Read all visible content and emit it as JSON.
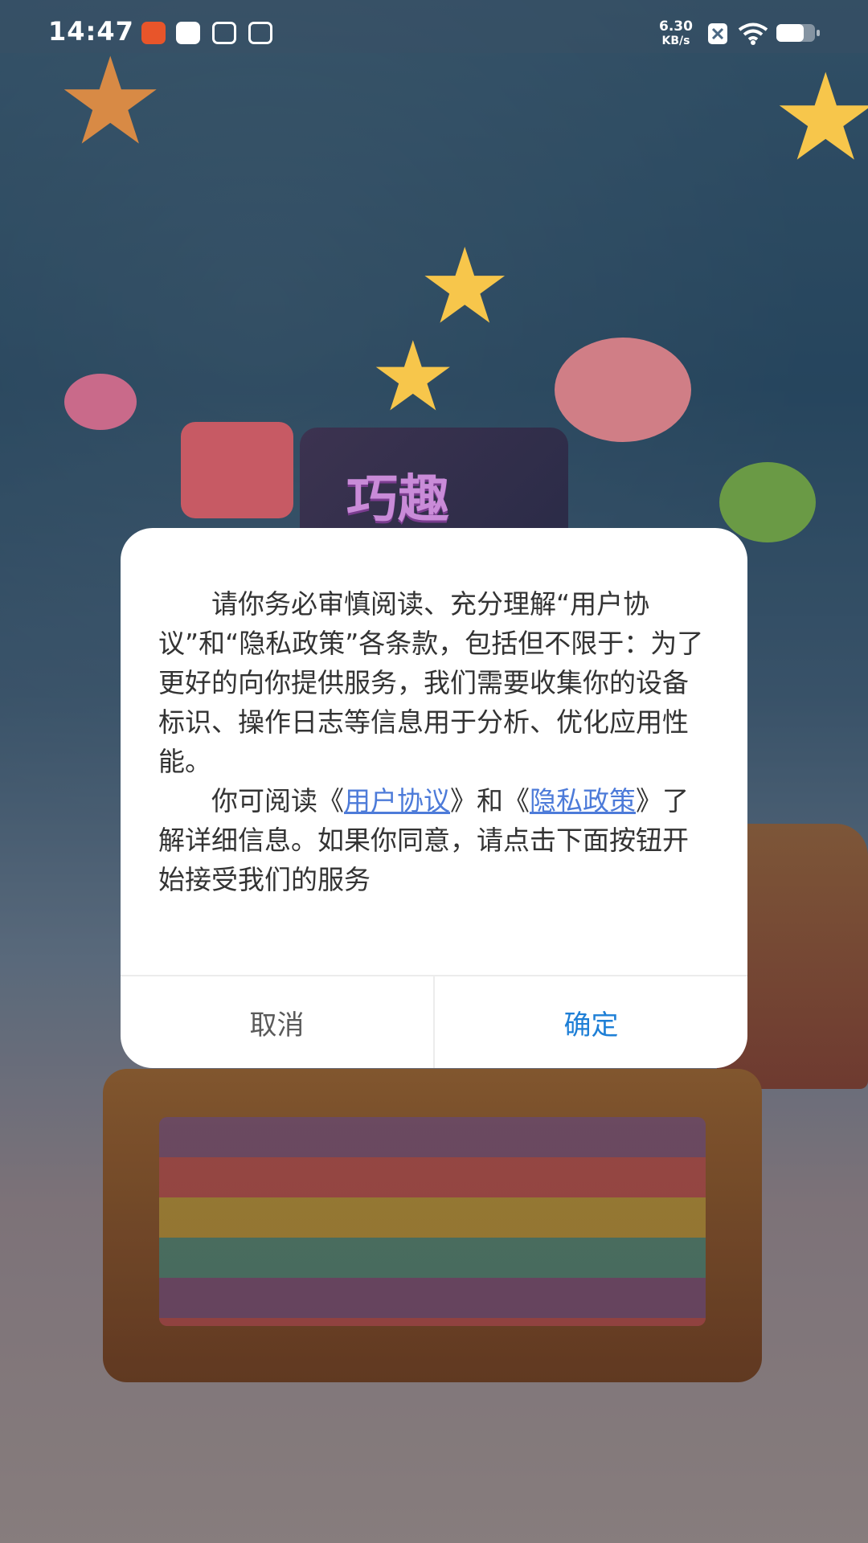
{
  "status_bar": {
    "time": "14:47",
    "network_speed_value": "6.30",
    "network_speed_unit": "KB/s"
  },
  "app_logo": {
    "text": "巧趣"
  },
  "dialog": {
    "paragraph1": "请你务必审慎阅读、充分理解“用户协议”和“隐私政策”各条款，包括但不限于：为了更好的向你提供服务，我们需要收集你的设备标识、操作日志等信息用于分析、优化应用性能。",
    "paragraph2_prefix": "你可阅读《",
    "user_agreement_link": "用户协议",
    "paragraph2_middle": "》和《",
    "privacy_policy_link": "隐私政策",
    "paragraph2_suffix": "》了解详细信息。如果你同意，请点击下面按钮开始接受我们的服务",
    "cancel_label": "取消",
    "confirm_label": "确定"
  },
  "colors": {
    "confirm": "#1e7fd6",
    "link": "#4d7bd9",
    "cancel": "#5a5a5a"
  }
}
